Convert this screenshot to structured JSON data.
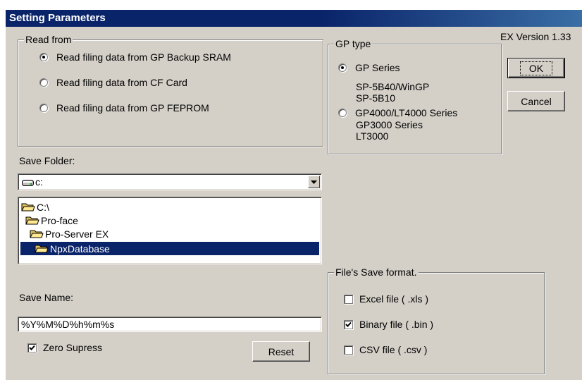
{
  "window": {
    "title": "Setting Parameters",
    "version": "EX Version 1.33"
  },
  "read_from": {
    "legend": "Read from",
    "options": [
      {
        "label": "Read filing data from GP Backup SRAM",
        "selected": true
      },
      {
        "label": "Read filing data from CF Card",
        "selected": false
      },
      {
        "label": "Read filing data from GP FEPROM",
        "selected": false
      }
    ]
  },
  "gp_type": {
    "legend": "GP type",
    "options": [
      {
        "label": "GP Series",
        "selected": true,
        "sub": [
          "SP-5B40/WinGP",
          "SP-5B10"
        ]
      },
      {
        "label": "GP4000/LT4000 Series",
        "selected": false,
        "sub": [
          "GP3000 Series",
          "LT3000"
        ]
      }
    ]
  },
  "buttons": {
    "ok": "OK",
    "cancel": "Cancel",
    "reset": "Reset"
  },
  "save_folder": {
    "label": "Save Folder:",
    "drive": "c:",
    "tree": [
      {
        "name": "C:\\",
        "selected": false
      },
      {
        "name": "Pro-face",
        "selected": false
      },
      {
        "name": "Pro-Server EX",
        "selected": false
      },
      {
        "name": "NpxDatabase",
        "selected": true
      }
    ]
  },
  "save_name": {
    "label": "Save Name:",
    "value": "%Y%M%D%h%m%s"
  },
  "zero_supress": {
    "label": "Zero Supress",
    "checked": true
  },
  "save_format": {
    "legend": "File's Save format.",
    "options": [
      {
        "label": "Excel file  ( .xls )",
        "checked": false
      },
      {
        "label": "Binary file ( .bin )",
        "checked": true
      },
      {
        "label": "CSV file ( .csv )",
        "checked": false
      }
    ]
  },
  "colors": {
    "title_bar": "#0a246a",
    "face": "#d4d0c8",
    "selection": "#0a246a"
  }
}
